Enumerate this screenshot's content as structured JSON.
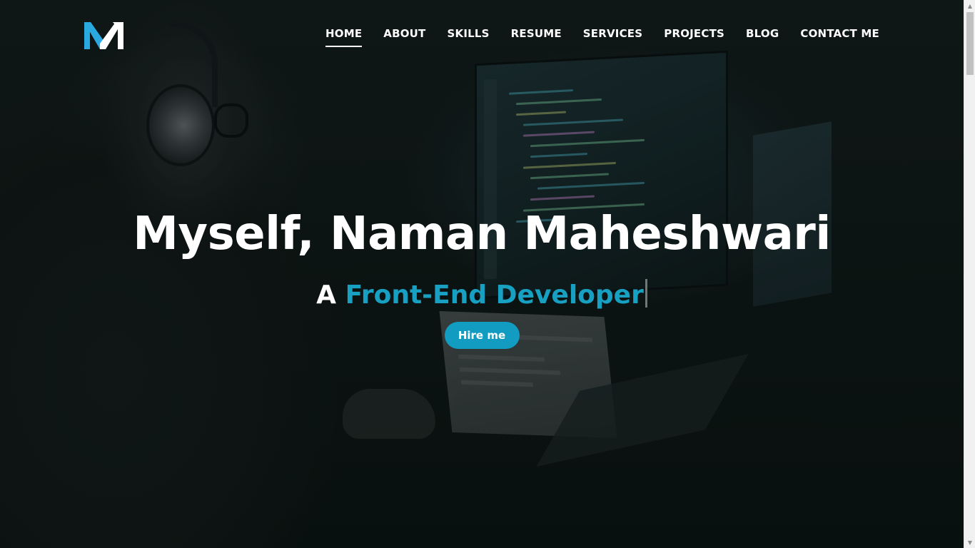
{
  "colors": {
    "accent": "#129cc1",
    "role_text": "#18a0c2",
    "logo_blue": "#2aa9e0",
    "logo_white": "#ffffff",
    "background": "#0d1514"
  },
  "logo": {
    "text": "NM",
    "icon": "nm-logo-icon"
  },
  "nav": {
    "items": [
      {
        "label": "HOME",
        "active": true
      },
      {
        "label": "ABOUT",
        "active": false
      },
      {
        "label": "SKILLS",
        "active": false
      },
      {
        "label": "RESUME",
        "active": false
      },
      {
        "label": "SERVICES",
        "active": false
      },
      {
        "label": "PROJECTS",
        "active": false
      },
      {
        "label": "BLOG",
        "active": false
      },
      {
        "label": "CONTACT ME",
        "active": false
      }
    ]
  },
  "hero": {
    "title": "Myself, Naman Maheshwari",
    "subtitle_prefix": "A",
    "subtitle_role": "Front-End Developer",
    "cta_label": "Hire me"
  },
  "scrollbar": {
    "up_icon": "scroll-up-arrow-icon",
    "down_icon": "scroll-down-arrow-icon",
    "up_glyph": "▲",
    "down_glyph": "▼"
  }
}
